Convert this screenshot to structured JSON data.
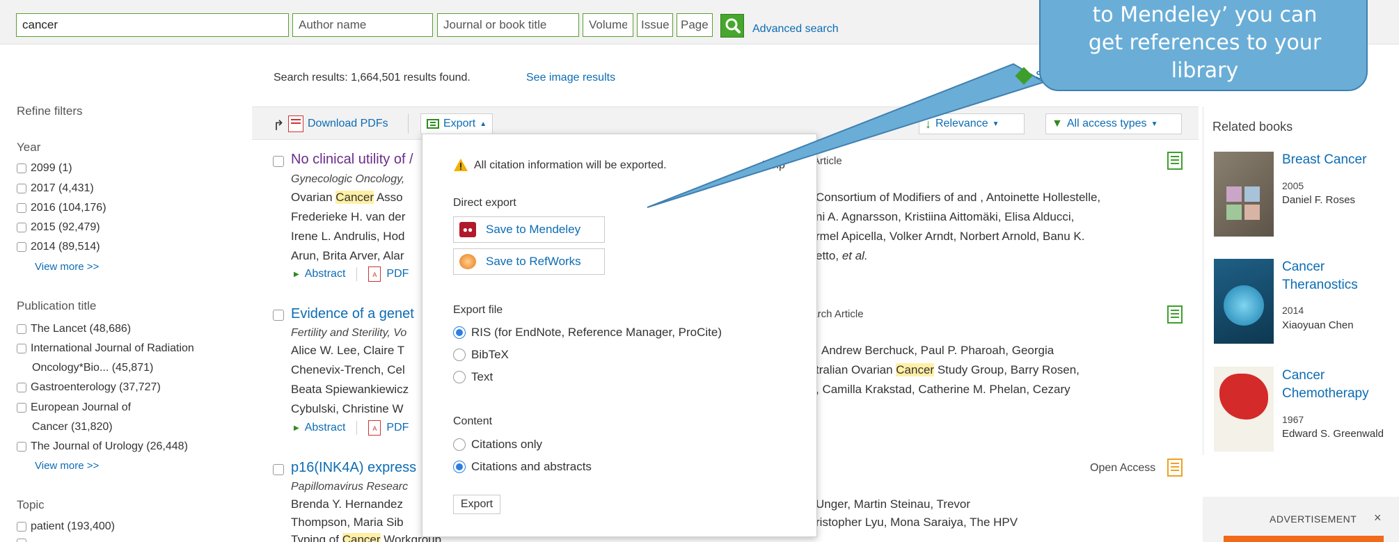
{
  "search": {
    "query_value": "cancer",
    "author_placeholder": "Author name",
    "journal_placeholder": "Journal or book title",
    "volume_placeholder": "Volume",
    "issue_placeholder": "Issue",
    "page_placeholder": "Page",
    "advanced_label": "Advanced search"
  },
  "summary": {
    "results_text": "Search results: 1,664,501 results found.",
    "image_results": "See image results"
  },
  "filters": {
    "heading": "Refine filters",
    "year_heading": "Year",
    "years": [
      "2099 (1)",
      "2017 (4,431)",
      "2016 (104,176)",
      "2015 (92,479)",
      "2014 (89,514)"
    ],
    "view_more": "View more >>",
    "pub_heading": "Publication title",
    "pub_1": "The Lancet (48,686)",
    "pub_2a": "International Journal of Radiation",
    "pub_2b": "Oncology*Bio... (45,871)",
    "pub_3": "Gastroenterology (37,727)",
    "pub_4a": "European Journal of",
    "pub_4b": "Cancer (31,820)",
    "pub_5": "The Journal of Urology (26,448)",
    "topic_heading": "Topic",
    "topic_1": "patient (193,400)"
  },
  "toolbar": {
    "download_label": "Download PDFs",
    "export_label": "Export",
    "relevance_label": "Relevance",
    "access_label": "All access types"
  },
  "results": [
    {
      "title": "No clinical utility of /",
      "source": "Gynecologic Oncology,",
      "type": "Article",
      "line1a": "Ovarian ",
      "line1hl": "Cancer",
      "line1b": " Asso",
      "line1r": "Consortium of Modifiers of and , Antoinette Hollestelle,",
      "line2a": "Frederieke H. van der",
      "line2r": "ni A. Agnarsson, Kristiina Aittomäki, Elisa Alducci,",
      "line3a": "Irene L. Andrulis, Hod",
      "line3r": "rmel Apicella, Volker Arndt, Norbert Arnold, Banu K.",
      "line4a": "Arun, Brita Arver, Alar",
      "line4r": "etto, ",
      "line4etal": "et al."
    },
    {
      "title": "Evidence of a genet",
      "source": "Fertility and Sterility, Vo",
      "type": "earch Article",
      "line1a": "Alice W. Lee, Claire T",
      "line1r": "Andrew Berchuck, Paul P. Pharoah, Georgia",
      "line2a": "Chenevix-Trench, Cel",
      "line2ra": "tralian Ovarian ",
      "line2rhl": "Cancer",
      "line2rb": " Study Group, Barry Rosen,",
      "line3a": "Beata Spiewankiewicz",
      "line3r": ", Camilla Krakstad, Catherine M. Phelan, Cezary",
      "line4a": "Cybulski, Christine W"
    },
    {
      "title": "p16(INK4A) express",
      "source": "Papillomavirus Researc",
      "access": "Open Access",
      "line1a": "Brenda Y. Hernandez",
      "line1r": "Unger, Martin Steinau, Trevor",
      "line2a": "Thompson, Maria Sib",
      "line2r": "ristopher Lyu, Mona Saraiya, The HPV",
      "line3a": "Typing of ",
      "line3hl": "Cancer",
      "line3b": " Workgroup"
    }
  ],
  "links": {
    "abstract": "Abstract",
    "pdf": "PDF"
  },
  "export_menu": {
    "warning": "All citation information will be exported.",
    "help": "Help",
    "direct_heading": "Direct export",
    "mendeley": "Save to Mendeley",
    "refworks": "Save to RefWorks",
    "file_heading": "Export file",
    "ris": "RIS (for EndNote, Reference Manager, ProCite)",
    "bibtex": "BibTeX",
    "text": "Text",
    "content_heading": "Content",
    "citations_only": "Citations only",
    "citations_abstracts": "Citations and abstracts",
    "export_button": "Export"
  },
  "related": {
    "heading": "Related books",
    "books": [
      {
        "title_1": "Breast Cancer",
        "year": "2005",
        "author": "Daniel F. Roses"
      },
      {
        "title_1": "Cancer",
        "title_2": "Theranostics",
        "year": "2014",
        "author": "Xiaoyuan Chen"
      },
      {
        "title_1": "Cancer",
        "title_2": "Chemotherapy",
        "year": "1967",
        "author": "Edward S. Greenwald"
      }
    ],
    "ad_label": "ADVERTISEMENT",
    "ad_close": "×"
  },
  "callout": {
    "line1": "to Mendeley’ you can",
    "line2": "get references to your",
    "line3": "library"
  },
  "colors": {
    "link": "#0c6cb4",
    "search_button": "#46a62d",
    "highlight": "#fff0a6",
    "callout": "#6aaed7",
    "radio_selected": "#2b7fe0"
  }
}
